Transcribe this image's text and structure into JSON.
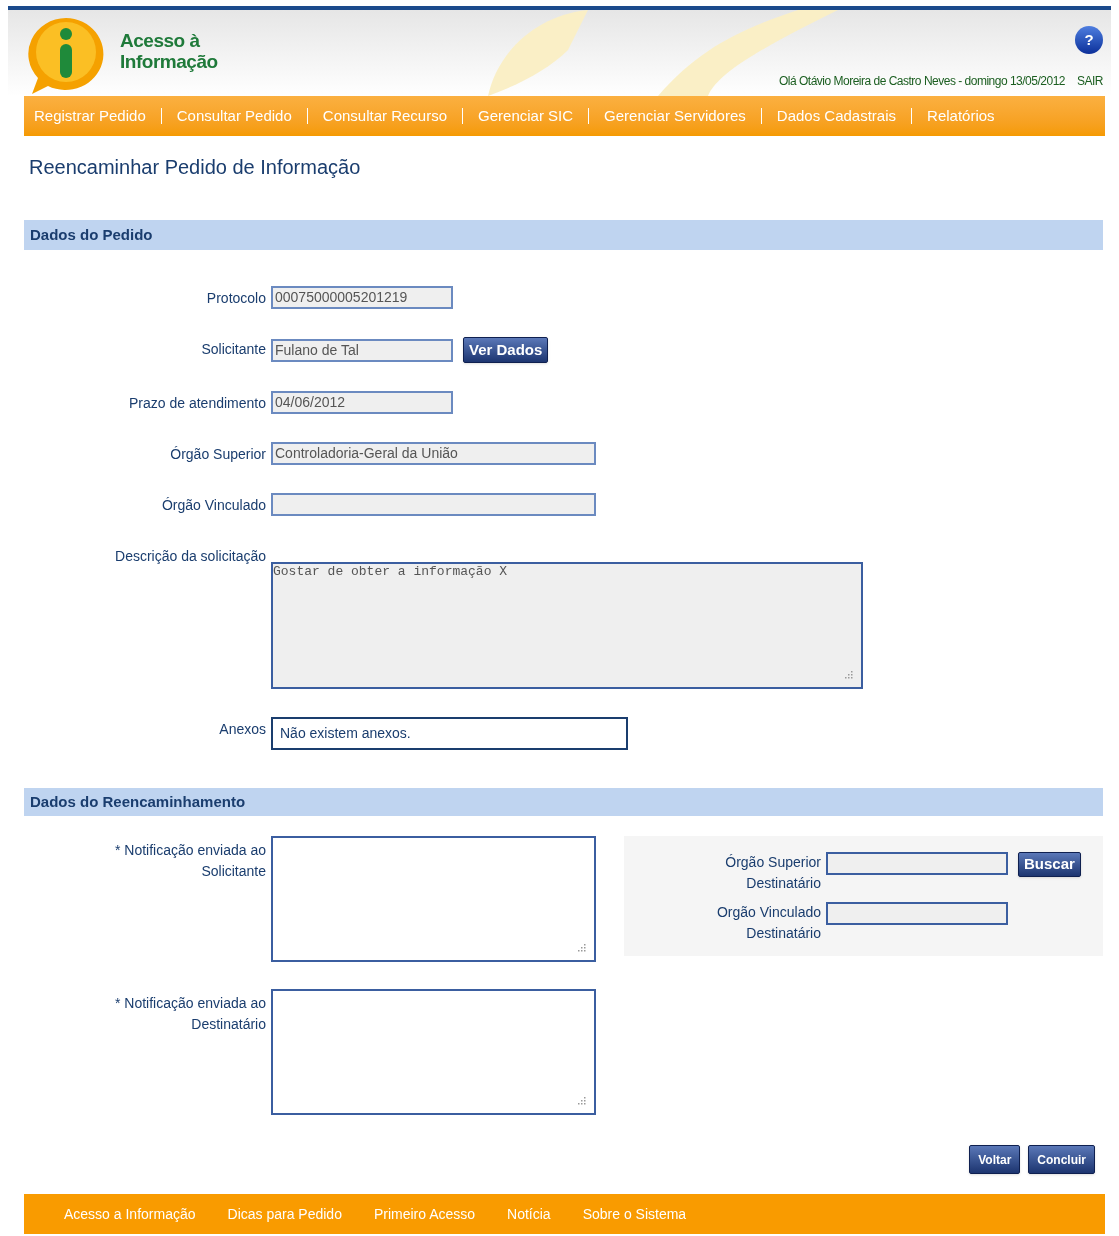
{
  "header": {
    "logo_line1": "Acesso à",
    "logo_line2": "Informação",
    "help": "?",
    "greeting": "Olá Otávio Moreira de Castro Neves - domingo 13/05/2012",
    "logout": "SAIR"
  },
  "nav": [
    "Registrar Pedido",
    "Consultar Pedido",
    "Consultar Recurso",
    "Gerenciar SIC",
    "Gerenciar Servidores",
    "Dados Cadastrais",
    "Relatórios"
  ],
  "page_title": "Reencaminhar Pedido de Informação",
  "pedido": {
    "heading": "Dados do Pedido",
    "fields": [
      {
        "kind": "short_input",
        "label": "Protocolo",
        "value": "00075000005201219"
      },
      {
        "kind": "short_input",
        "label": "Solicitante",
        "value": "Fulano de Tal",
        "button": "Ver Dados"
      },
      {
        "kind": "short_input",
        "label": "Prazo de atendimento",
        "value": "04/06/2012"
      },
      {
        "kind": "long_input",
        "label": "Órgão Superior",
        "value": "Controladoria-Geral da União"
      },
      {
        "kind": "long_input",
        "label": "Órgão Vinculado"
      },
      {
        "kind": "textarea",
        "label": "Descrição da solicitação",
        "value": "Gostar de obter a informação X"
      },
      {
        "kind": "box",
        "label": "Anexos",
        "value": "Não existem anexos."
      }
    ]
  },
  "reencaminhamento": {
    "heading": "Dados do Reencaminhamento",
    "notes": [
      {
        "label_line1": "* Notificação enviada ao",
        "label_line2": "Solicitante"
      },
      {
        "label_line1": "* Notificação enviada ao",
        "label_line2": "Destinatário"
      }
    ],
    "destino": [
      {
        "label_line1": "Órgão Superior",
        "label_line2": "Destinatário",
        "button": "Buscar"
      },
      {
        "label_line1": "Orgão Vinculado",
        "label_line2": "Destinatário"
      }
    ]
  },
  "actions": [
    "Voltar",
    "Concluir"
  ],
  "footer": [
    "Acesso a Informação",
    "Dicas para Pedido",
    "Primeiro Acesso",
    "Notícia",
    "Sobre o Sistema"
  ]
}
